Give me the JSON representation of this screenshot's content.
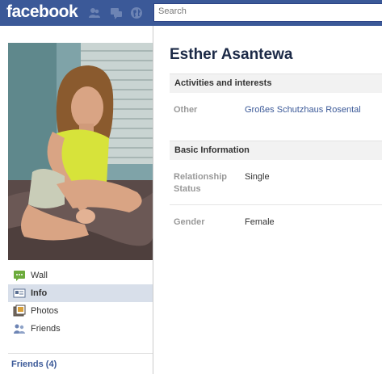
{
  "topbar": {
    "logo": "facebook",
    "search_placeholder": "Search"
  },
  "profile": {
    "name": "Esther Asantewa"
  },
  "nav": {
    "items": [
      {
        "label": "Wall",
        "icon": "wall-icon"
      },
      {
        "label": "Info",
        "icon": "info-icon"
      },
      {
        "label": "Photos",
        "icon": "photos-icon"
      },
      {
        "label": "Friends",
        "icon": "friends-icon"
      }
    ],
    "active": "Info",
    "friends_link": "Friends (4)"
  },
  "sections": {
    "activities": {
      "title": "Activities and interests",
      "other_label": "Other",
      "other_value": "Großes Schutzhaus Rosental"
    },
    "basic": {
      "title": "Basic Information",
      "relationship_label": "Relationship Status",
      "relationship_value": "Single",
      "gender_label": "Gender",
      "gender_value": "Female"
    }
  },
  "colors": {
    "brand": "#3b5998",
    "nav_active": "#d8dfea",
    "link": "#3b5998"
  }
}
